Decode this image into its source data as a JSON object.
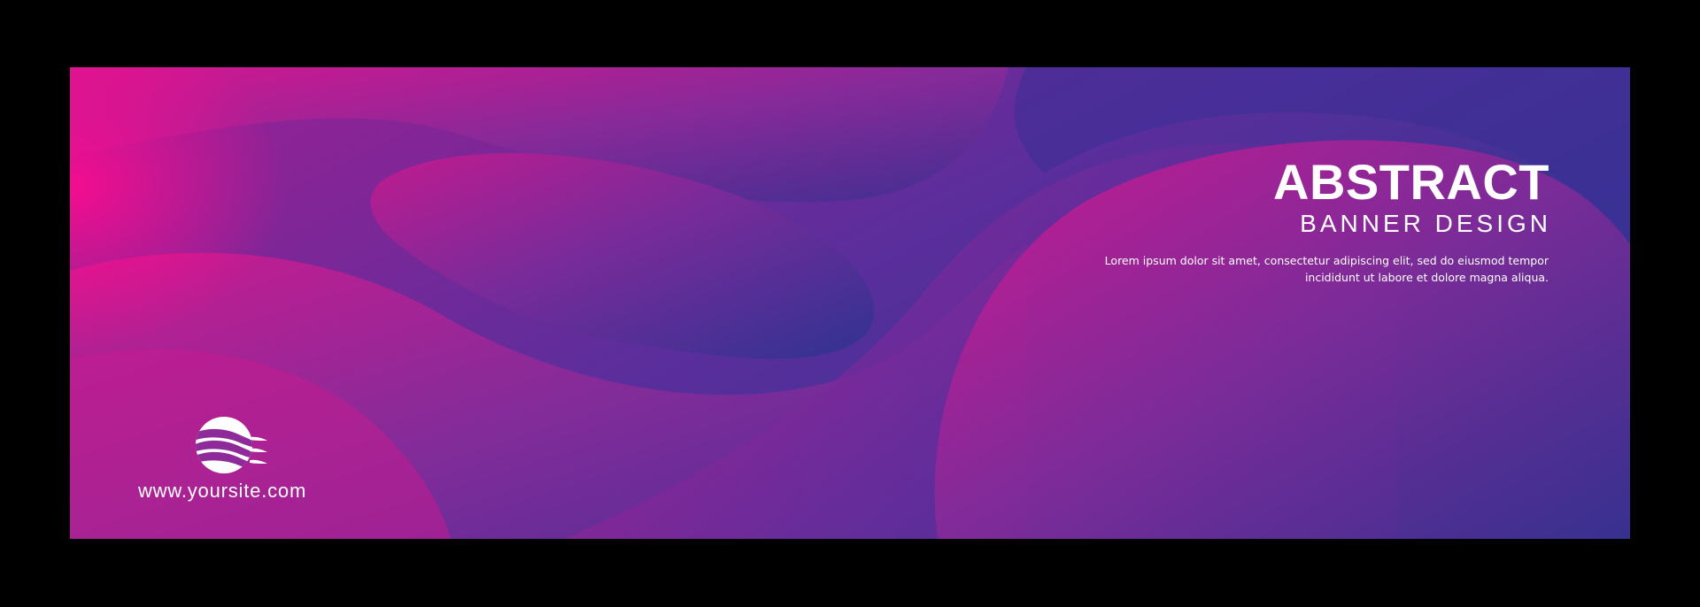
{
  "banner": {
    "title": "ABSTRACT",
    "subtitle": "BANNER DESIGN",
    "body_line_1": "Lorem ipsum dolor sit amet, consectetur adipiscing elit, sed do eiusmod tempor",
    "body_line_2": "incididunt ut labore et dolore magna aliqua.",
    "website": "www.yoursite.com",
    "logo_icon": "sphere-waves-logo-icon"
  },
  "colors": {
    "background": "#000000",
    "magenta": "#e0148f",
    "purple": "#7b2c9b",
    "indigo": "#2f3391",
    "text": "#ffffff"
  }
}
